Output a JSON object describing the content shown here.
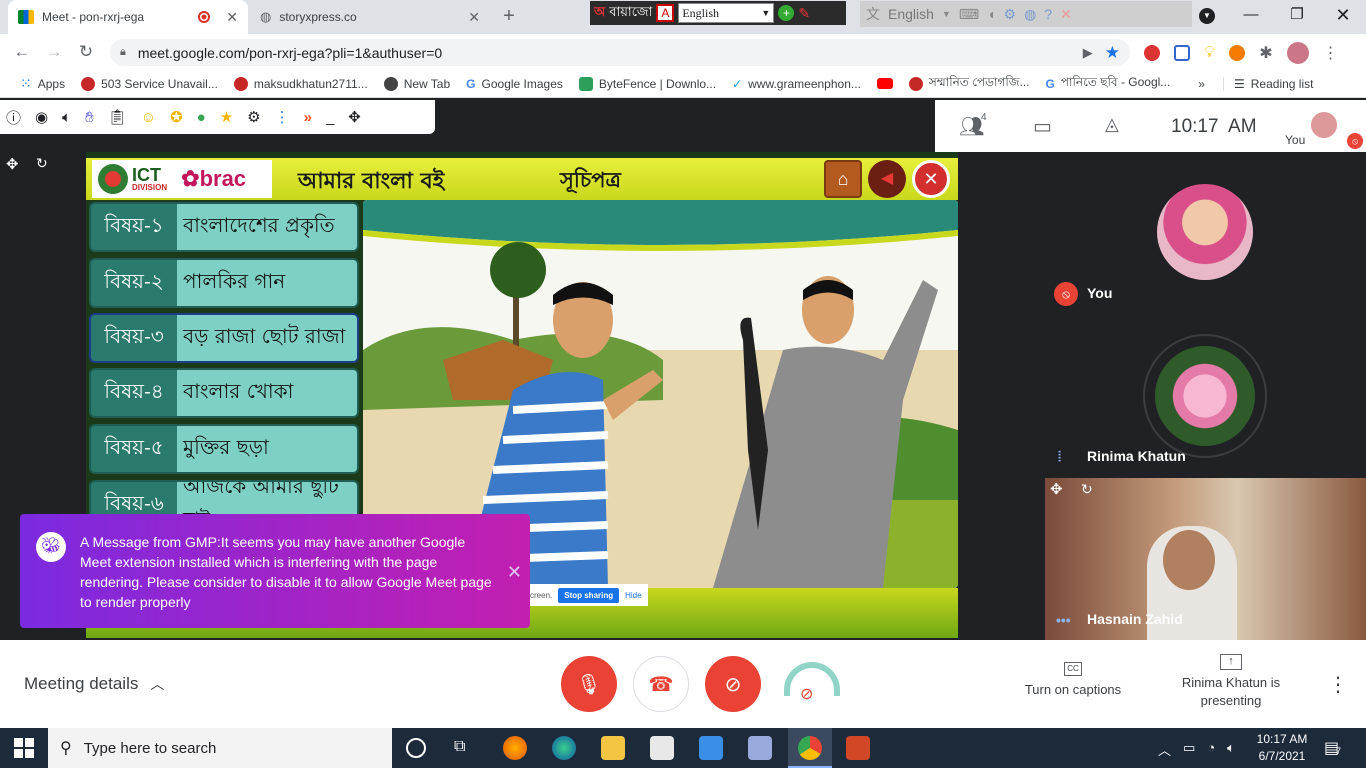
{
  "browser": {
    "tabs": [
      {
        "title": "Meet - pon-rxrj-ega",
        "active": true
      },
      {
        "title": "storyxpress.co",
        "active": false
      }
    ],
    "lang_widget_1": "বায়াজো",
    "lang_select": "English",
    "lang_widget_2": "English",
    "url": "meet.google.com/pon-rxrj-ega?pli=1&authuser=0",
    "bookmarks": [
      "Apps",
      "503 Service Unavail...",
      "maksudkhatun2711...",
      "New Tab",
      "Google Images",
      "ByteFence | Downlo...",
      "www.grameenphon...",
      "সম্মানিত পেডাগজি...",
      "পানিতে ছবি - Googl..."
    ],
    "overflow": "»",
    "reading_list": "Reading list"
  },
  "meet": {
    "participant_count": "4",
    "clock": "10:17  AM",
    "self_label": "You",
    "participants": [
      {
        "name": "You"
      },
      {
        "name": "Rinima Khatun"
      },
      {
        "name": "Hasnain Zahid"
      }
    ],
    "meeting_details": "Meeting details",
    "captions": "Turn on captions",
    "presenting": "Rinima Khatun is presenting"
  },
  "lesson": {
    "brand1": "ICT",
    "brand1_sub": "DIVISION",
    "brand2": "brac",
    "book_title": "আমার বাংলা বই",
    "index_title": "সূচিপত্র",
    "topics": [
      {
        "num": "বিষয়-১",
        "name": "বাংলাদেশের প্রকৃতি"
      },
      {
        "num": "বিষয়-২",
        "name": "পালকির গান"
      },
      {
        "num": "বিষয়-৩",
        "name": "বড় রাজা ছোট রাজা"
      },
      {
        "num": "বিষয়-৪",
        "name": "বাংলার খোকা"
      },
      {
        "num": "বিষয়-৫",
        "name": "মুক্তির ছড়া"
      },
      {
        "num": "বিষয়-৬",
        "name": "আজকে আমার ছুটি চাই"
      }
    ],
    "share_text": "creen.",
    "stop_sharing": "Stop sharing",
    "hide": "Hide"
  },
  "toast": {
    "message": "A Message from GMP:It seems you may have another Google Meet extension installed which is interfering with the page rendering. Please consider to disable it to allow Google Meet page to render properly"
  },
  "taskbar": {
    "search_placeholder": "Type here to search",
    "time": "10:17 AM",
    "date": "6/7/2021",
    "notifications": "7"
  },
  "colors": {
    "meet_bg": "#202124",
    "red": "#ea4335",
    "toast_start": "#7b2ae0",
    "toast_end": "#c31fb0",
    "teal": "#2a7a6e"
  }
}
